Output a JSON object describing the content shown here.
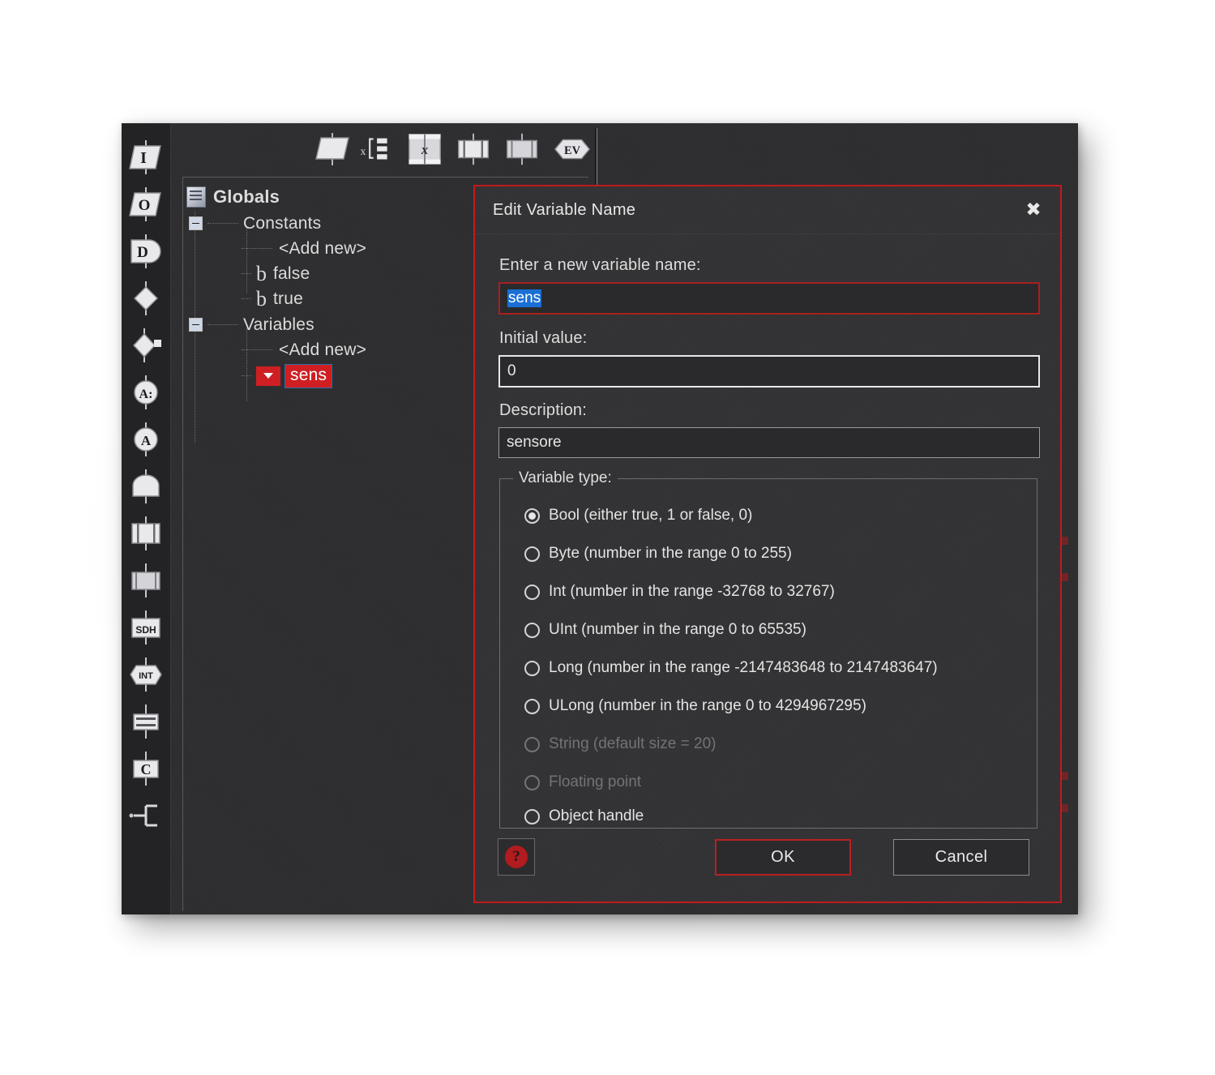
{
  "window": {
    "left_toolbar": {
      "icons": [
        {
          "name": "input-block-icon",
          "glyph": "I"
        },
        {
          "name": "output-block-icon",
          "glyph": "O"
        },
        {
          "name": "decision-block-icon",
          "glyph": "D"
        },
        {
          "name": "connection-point-icon",
          "glyph": ""
        },
        {
          "name": "connection-point-plug-icon",
          "glyph": ""
        },
        {
          "name": "analog-input-icon",
          "glyph": "A:"
        },
        {
          "name": "analog-output-icon",
          "glyph": "A"
        },
        {
          "name": "interrupt-block-icon",
          "glyph": ""
        },
        {
          "name": "timer-block-icon",
          "glyph": ""
        },
        {
          "name": "pwm-block-icon",
          "glyph": ""
        },
        {
          "name": "sdh-block-icon",
          "glyph": "SDH"
        },
        {
          "name": "int-block-icon",
          "glyph": "INT"
        },
        {
          "name": "list-block-icon",
          "glyph": ""
        },
        {
          "name": "comment-block-icon",
          "glyph": "C"
        },
        {
          "name": "loop-block-icon",
          "glyph": ""
        }
      ]
    },
    "top_toolbar": {
      "icons": [
        {
          "name": "new-flowchart-icon"
        },
        {
          "name": "variable-list-icon"
        },
        {
          "name": "calculation-icon"
        },
        {
          "name": "subroutine-icon"
        },
        {
          "name": "macro-icon"
        },
        {
          "name": "event-icon",
          "glyph": "EV"
        }
      ]
    },
    "tree": {
      "root": {
        "label": "Globals"
      },
      "nodes": [
        {
          "label": "Constants",
          "kind": "group"
        },
        {
          "label": "<Add new>",
          "kind": "add"
        },
        {
          "label": "false",
          "kind": "bool"
        },
        {
          "label": "true",
          "kind": "bool"
        },
        {
          "label": "Variables",
          "kind": "group"
        },
        {
          "label": "<Add new>",
          "kind": "add"
        },
        {
          "label": "sens",
          "kind": "variable",
          "selected": true
        }
      ]
    }
  },
  "dialog": {
    "title": "Edit Variable Name",
    "close_glyph": "✖",
    "name_label": "Enter a new variable name:",
    "name_value": "sens",
    "initial_value_label": "Initial value:",
    "initial_value": "0",
    "description_label": "Description:",
    "description_value": "sensore",
    "type_group_title": "Variable type:",
    "type_options": [
      {
        "label": "Bool (either true, 1 or false, 0)",
        "checked": true,
        "disabled": false
      },
      {
        "label": "Byte (number in the range 0 to 255)",
        "checked": false,
        "disabled": false
      },
      {
        "label": "Int (number in the range -32768 to 32767)",
        "checked": false,
        "disabled": false
      },
      {
        "label": "UInt (number in the range 0 to 65535)",
        "checked": false,
        "disabled": false
      },
      {
        "label": "Long (number in the range -2147483648 to 2147483647)",
        "checked": false,
        "disabled": false
      },
      {
        "label": "ULong (number in the range 0 to 4294967295)",
        "checked": false,
        "disabled": false
      },
      {
        "label": "String (default size = 20)",
        "checked": false,
        "disabled": true
      },
      {
        "label": "Floating point",
        "checked": false,
        "disabled": true
      },
      {
        "label": "Object handle",
        "checked": false,
        "disabled": false
      }
    ],
    "help_glyph": "?",
    "ok_label": "OK",
    "cancel_label": "Cancel"
  },
  "colors": {
    "accent_red": "#c01a1d",
    "selection_blue": "#1a6fd4",
    "window_bg": "#2e2e30",
    "dialog_bg": "#333335"
  }
}
